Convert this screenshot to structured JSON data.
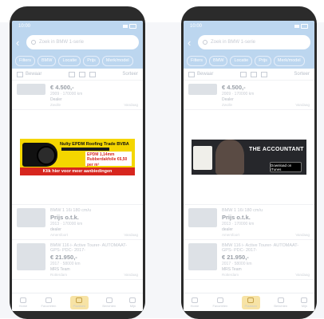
{
  "phones": [
    {
      "status_time": "10:00",
      "search_placeholder": "Zoek in BMW 1-serie",
      "filter_chips": [
        "Filters",
        "BMW",
        "Locatie",
        "Prijs",
        "Merk/model"
      ],
      "sort_label": "Bewaar",
      "filter_label": "Sorteer",
      "listing_top": {
        "price": "€ 4.500,-",
        "meta": "2009 · 170000 km",
        "seller": "Dealer",
        "location": "Zwolle",
        "tag": "Vandaag"
      },
      "ad": {
        "type": "roof",
        "headline": "Nulty EPDM Roofing Trade BVBA",
        "box_text": "EPDM 1,14mm Rubberdakfolie €6,50 per m²",
        "cta": "Klik hier voor meer aanbiedingen"
      },
      "listing_mid": {
        "title": "BMW 1 16i 180 cm/u",
        "price": "Prijs o.t.k.",
        "meta": "2013 · 170000 km",
        "seller": "dealer",
        "location": "Amersfoort",
        "tag": "Vandaag"
      },
      "listing_bottom": {
        "title": "BMW 116 i- Active Tourer- AUTOMAAT- GPS- PDC- 2017-",
        "price": "€ 21.950,-",
        "meta": "2017 · 58000 km",
        "seller": "MRS Team",
        "location": "Rotterdam",
        "tag": "Vandaag"
      },
      "nav": [
        "Home",
        "Favorieten",
        "Plaatsen",
        "Berichten",
        "Mijn"
      ]
    },
    {
      "status_time": "10:00",
      "search_placeholder": "Zoek in BMW 1-serie",
      "filter_chips": [
        "Filters",
        "BMW",
        "Locatie",
        "Prijs",
        "Merk/model"
      ],
      "sort_label": "Bewaar",
      "filter_label": "Sorteer",
      "listing_top": {
        "price": "€ 4.500,-",
        "meta": "2009 · 170000 km",
        "seller": "Dealer",
        "location": "Zwolle",
        "tag": "Vandaag"
      },
      "ad": {
        "type": "movie",
        "movie_title": "THE ACCOUNTANT",
        "store_label": "Download on iTunes"
      },
      "listing_mid": {
        "title": "BMW 1 16i 180 cm/u",
        "price": "Prijs o.t.k.",
        "meta": "2013 · 170000 km",
        "seller": "dealer",
        "location": "Amersfoort",
        "tag": "Vandaag"
      },
      "listing_bottom": {
        "title": "BMW 116 i- Active Tourer- AUTOMAAT- GPS- PDC- 2017-",
        "price": "€ 21.950,-",
        "meta": "2017 · 58000 km",
        "seller": "MRS Team",
        "location": "Rotterdam",
        "tag": "Vandaag"
      },
      "nav": [
        "Home",
        "Favorieten",
        "Plaatsen",
        "Berichten",
        "Mijn"
      ]
    }
  ],
  "colors": {
    "header": "#bcd6ef",
    "ad_yellow": "#f4d600",
    "ad_red": "#d7261e",
    "nav_active": "#f7e3a5"
  }
}
